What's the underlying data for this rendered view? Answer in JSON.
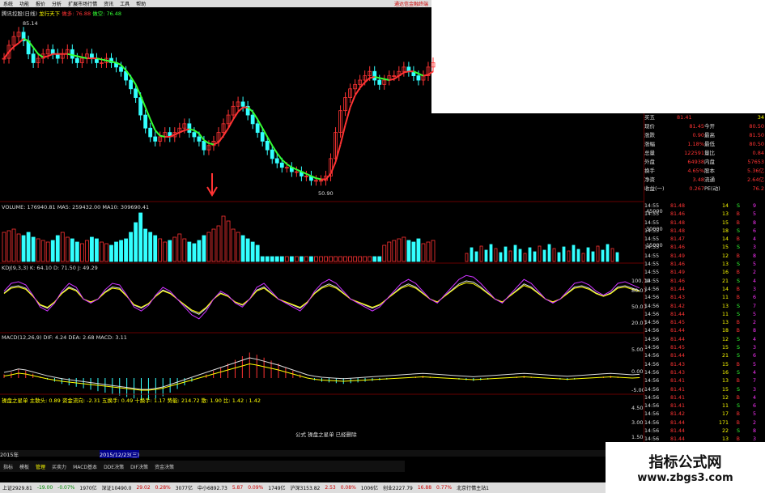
{
  "menu": [
    "系统",
    "功能",
    "报价",
    "分析",
    "扩展市场行情",
    "资讯",
    "工具",
    "帮助"
  ],
  "menu_right": "通达信金融终端",
  "colors": {
    "up": "#ff3333",
    "down": "#33ffff",
    "ma": "#ffff00",
    "bg": "#000000"
  },
  "kline_header": {
    "stock": "腾讯控股(日线)",
    "indicator": "龙行天下",
    "ind_val1": "做多: 76.88",
    "ind_val2": "做空: 76.48"
  },
  "high_label": "85.14",
  "low_label": "50.90",
  "volume_header": "VOLUME: 176940.81  MA5: 259432.00  MA10: 309690.41",
  "vol_axis": [
    "45000",
    "30000",
    "15000"
  ],
  "kdj_header": "KDJ(9,3,3)  K: 64.10  D: 71.50  J: 49.29",
  "kdj_axis": [
    "100.00",
    "80.00",
    "50.00",
    "20.00"
  ],
  "macd_header": "MACD(12,26,9)  DIF: 4.24  DEA: 2.68  MACD: 3.11",
  "macd_axis": [
    "5.00",
    "0.00",
    "-5.00"
  ],
  "bottom_ind_header": "操盘之星单  主散头: 0.89  资金流向: -2.31  五换手: 0.49  十换手: 1.17  势能: 214.72  散: 1.90  比: 1.42  : 1.42",
  "bottom_ind_axis": [
    "4.50",
    "3.00",
    "1.50"
  ],
  "center_msg": "公式 操盘之星单 已经删除",
  "date_bar": {
    "left": "2015年",
    "mid": "2015/12/23(三)"
  },
  "tabs": [
    "指标",
    "模板",
    "管理",
    "买卖力",
    "MACD基本",
    "DDE决策",
    "DIF决策",
    "资金决策"
  ],
  "status": [
    "上证2929.81",
    "-19.00",
    "-0.07%",
    "1970亿",
    "深证10490.0",
    "29.02",
    "0.28%",
    "3077亿",
    "中小6892.73",
    "5.87",
    "0.09%",
    "1749亿",
    "沪深3153.82",
    "2.53",
    "0.08%",
    "1006亿",
    "创业2227.79",
    "16.88",
    "0.77%",
    "北京行情主站1"
  ],
  "quote_panel": {
    "header": [
      "买五",
      "81.41",
      "34"
    ],
    "rows": [
      [
        "现价",
        "81.45",
        "今开",
        "80.50"
      ],
      [
        "涨跌",
        "0.90",
        "最高",
        "81.50"
      ],
      [
        "涨幅",
        "1.18%",
        "最低",
        "80.50"
      ],
      [
        "总量",
        "122591",
        "量比",
        "0.84"
      ],
      [
        "外盘",
        "64938",
        "内盘",
        "57653"
      ],
      [
        "换手",
        "4.65%",
        "股本",
        "5.36亿"
      ],
      [
        "净资",
        "3.48",
        "流通",
        "2.64亿"
      ],
      [
        "收益(一)",
        "0.267",
        "PE(动)",
        "76.2"
      ]
    ]
  },
  "ticks": [
    [
      "14:55",
      "81.48",
      "14",
      "S",
      "9"
    ],
    [
      "14:55",
      "81.46",
      "13",
      "B",
      "5"
    ],
    [
      "14:55",
      "81.48",
      "15",
      "B",
      "8"
    ],
    [
      "14:55",
      "81.48",
      "18",
      "S",
      "6"
    ],
    [
      "14:55",
      "81.47",
      "14",
      "B",
      "4"
    ],
    [
      "14:55",
      "81.46",
      "15",
      "S",
      "3"
    ],
    [
      "14:55",
      "81.49",
      "12",
      "B",
      "8"
    ],
    [
      "14:55",
      "81.46",
      "13",
      "S",
      "5"
    ],
    [
      "14:55",
      "81.49",
      "16",
      "B",
      "2"
    ],
    [
      "14:55",
      "81.46",
      "21",
      "S",
      "4"
    ],
    [
      "14:56",
      "81.44",
      "14",
      "B",
      "3"
    ],
    [
      "14:56",
      "81.43",
      "11",
      "B",
      "6"
    ],
    [
      "14:56",
      "81.42",
      "13",
      "S",
      "7"
    ],
    [
      "14:56",
      "81.44",
      "11",
      "S",
      "5"
    ],
    [
      "14:56",
      "81.45",
      "13",
      "B",
      "2"
    ],
    [
      "14:56",
      "81.44",
      "18",
      "B",
      "8"
    ],
    [
      "14:56",
      "81.44",
      "12",
      "S",
      "4"
    ],
    [
      "14:56",
      "81.45",
      "15",
      "S",
      "3"
    ],
    [
      "14:56",
      "81.44",
      "21",
      "S",
      "6"
    ],
    [
      "14:56",
      "81.43",
      "15",
      "B",
      "5"
    ],
    [
      "14:56",
      "81.43",
      "16",
      "S",
      "4"
    ],
    [
      "14:56",
      "81.41",
      "13",
      "B",
      "7"
    ],
    [
      "14:56",
      "81.41",
      "15",
      "S",
      "3"
    ],
    [
      "14:56",
      "81.41",
      "12",
      "B",
      "4"
    ],
    [
      "14:56",
      "81.41",
      "11",
      "S",
      "6"
    ],
    [
      "14:56",
      "81.42",
      "17",
      "B",
      "5"
    ],
    [
      "14:56",
      "81.44",
      "171",
      "B",
      "2"
    ],
    [
      "14:56",
      "81.44",
      "22",
      "S",
      "8"
    ],
    [
      "14:56",
      "81.44",
      "13",
      "B",
      "3"
    ],
    [
      "14:56",
      "81.45",
      "12",
      "S",
      "4"
    ],
    [
      "14:56",
      "81.45",
      "14",
      "S",
      "9"
    ]
  ],
  "watermark": {
    "title": "指标公式网",
    "url": "www.zbgs3.com"
  },
  "chart_data": {
    "type": "line",
    "title": "腾讯控股(日线)",
    "candles_close": [
      79,
      82,
      84,
      85,
      83,
      80,
      78,
      79,
      80,
      81,
      80,
      79,
      80,
      81,
      79,
      78,
      79,
      80,
      79,
      78,
      78,
      79,
      78,
      77,
      76,
      74,
      72,
      70,
      66,
      63,
      61,
      60,
      61,
      62,
      61,
      62,
      63,
      64,
      62,
      61,
      60,
      58,
      59,
      60,
      62,
      64,
      66,
      68,
      69,
      68,
      66,
      64,
      62,
      60,
      58,
      56,
      55,
      54,
      54,
      53,
      53,
      52,
      52,
      51,
      51,
      51,
      52,
      56,
      62,
      67,
      70,
      72,
      73,
      74,
      75,
      76,
      74,
      73,
      74,
      75,
      75,
      76,
      77,
      76,
      75,
      74,
      75,
      77,
      78
    ],
    "volume": [
      18,
      19,
      20,
      17,
      16,
      18,
      15,
      14,
      13,
      12,
      13,
      16,
      18,
      15,
      14,
      12,
      11,
      13,
      15,
      14,
      12,
      11,
      10,
      12,
      13,
      14,
      18,
      24,
      30,
      20,
      18,
      16,
      14,
      12,
      13,
      15,
      17,
      14,
      12,
      11,
      13,
      16,
      18,
      20,
      22,
      28,
      25,
      20,
      18,
      16,
      14,
      12,
      10,
      3,
      3,
      3,
      3,
      3,
      3,
      3,
      3,
      3,
      3,
      3,
      3,
      3,
      3,
      3,
      3,
      3,
      3,
      3,
      3,
      3,
      3,
      3,
      3,
      3,
      10,
      12,
      13,
      14,
      15,
      13,
      12,
      14,
      11,
      12,
      13
    ],
    "kdj_k": [
      60,
      70,
      72,
      68,
      55,
      40,
      35,
      45,
      60,
      70,
      65,
      50,
      45,
      50,
      62,
      70,
      68,
      55,
      40,
      35,
      42,
      55,
      65,
      60,
      50,
      40,
      30,
      25,
      35,
      50,
      60,
      55,
      45,
      40,
      50,
      65,
      70,
      60,
      50,
      45,
      40,
      35,
      45,
      60,
      70,
      75,
      70,
      60,
      50,
      45,
      40,
      35,
      40,
      50,
      60,
      70,
      75,
      70,
      60,
      50,
      45,
      55,
      65,
      75,
      80,
      78,
      70,
      60,
      50,
      45,
      55,
      65,
      75,
      70,
      60,
      50,
      45,
      50,
      60,
      70,
      72,
      68,
      60,
      55,
      60,
      70,
      72,
      68,
      64
    ],
    "macd_hist": [
      0.5,
      0.8,
      1.2,
      1,
      0.6,
      0.2,
      -0.2,
      -0.5,
      -0.8,
      -1,
      -1.2,
      -1.4,
      -1.6,
      -1.8,
      -2,
      -2.2,
      -2.4,
      -2.6,
      -2.8,
      -3,
      -3,
      -2.8,
      -2.5,
      -2,
      -1.5,
      -1,
      -0.5,
      0,
      0.5,
      1,
      1.5,
      2,
      2.5,
      3,
      3.5,
      3.2,
      2.8,
      2.4,
      2,
      1.5,
      1,
      0.5,
      0,
      -0.3,
      -0.5,
      -0.6,
      -0.7,
      -0.8,
      -0.7,
      -0.6,
      -0.5,
      -0.4,
      -0.3,
      -0.2,
      -0.1,
      0,
      0.1,
      0.2,
      0.3,
      0.2,
      0.1,
      0,
      -0.1,
      -0.2,
      -0.3,
      -0.4,
      -0.3,
      -0.2,
      -0.1,
      0,
      0.1,
      0.2,
      0.3,
      0.2,
      0.1,
      0,
      -0.1,
      -0.2,
      -0.3,
      -0.2,
      -0.1,
      0,
      0.1,
      0.2,
      0.3,
      0.2,
      0.1,
      0,
      0.1
    ],
    "ylim": [
      48,
      87
    ]
  }
}
